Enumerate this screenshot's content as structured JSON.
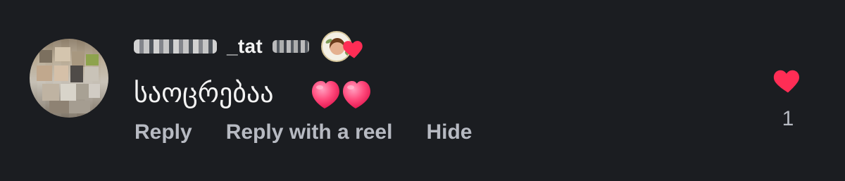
{
  "comment": {
    "username_suffix": "_tat",
    "text": "საოცრებაა",
    "actions": {
      "reply": "Reply",
      "reply_with_reel": "Reply with a reel",
      "hide": "Hide"
    },
    "likes": "1"
  },
  "colors": {
    "background": "#1b1d21",
    "text_primary": "#f3f3f3",
    "text_secondary": "#b7bac2",
    "heart": "#ff2d55"
  },
  "icons": {
    "avatar": "user-avatar-blurred",
    "badge": "profile-badge-icon",
    "badge_heart": "heart-icon",
    "text_hearts": "pink-heart-emoji",
    "like": "heart-icon"
  }
}
